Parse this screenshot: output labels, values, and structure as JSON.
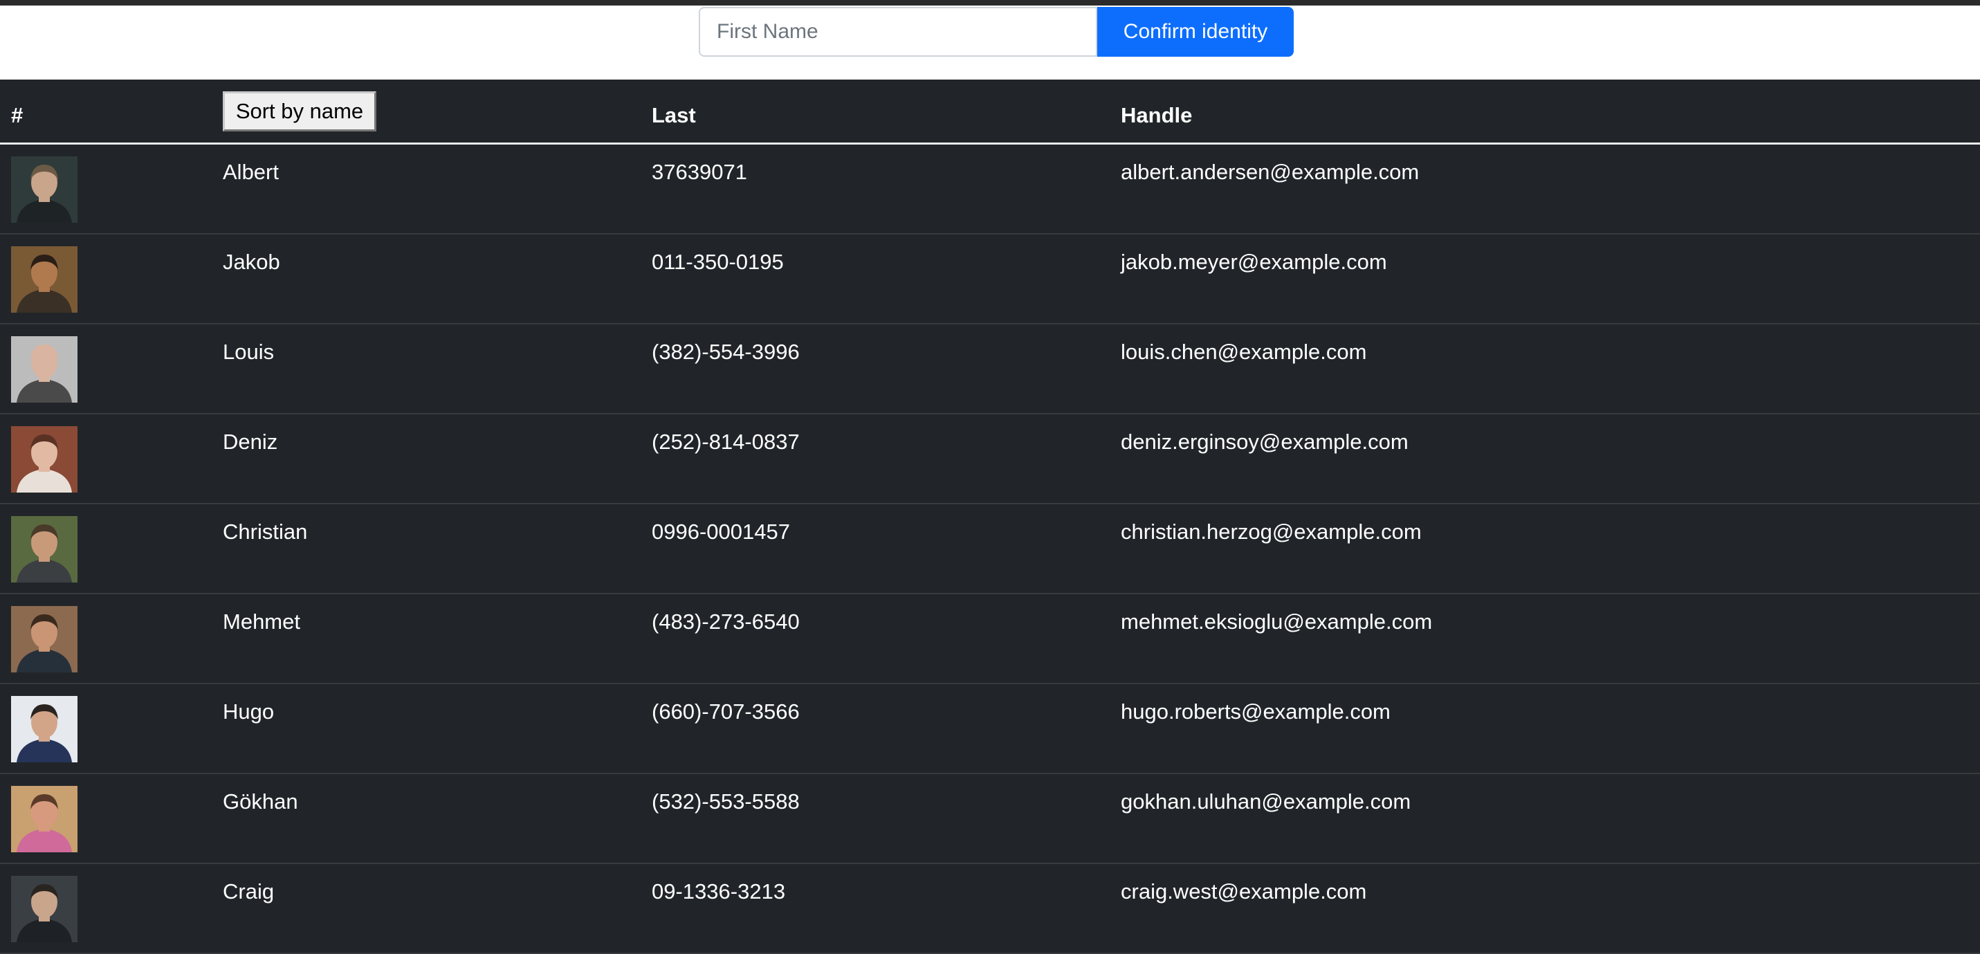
{
  "search": {
    "placeholder": "First Name",
    "value": "",
    "button_label": "Confirm identity"
  },
  "table": {
    "headers": {
      "index": "#",
      "sort_button": "Sort by name",
      "last": "Last",
      "handle": "Handle"
    },
    "rows": [
      {
        "first": "Albert",
        "last": "37639071",
        "handle": "albert.andersen@example.com",
        "bg": "#2f3b3a",
        "skin": "#c9a58c",
        "hair": "#6b5a45",
        "shirt": "#1e2426"
      },
      {
        "first": "Jakob",
        "last": "011-350-0195",
        "handle": "jakob.meyer@example.com",
        "bg": "#7a5a35",
        "skin": "#b07a4e",
        "hair": "#2a1e16",
        "shirt": "#3b3026"
      },
      {
        "first": "Louis",
        "last": "(382)-554-3996",
        "handle": "louis.chen@example.com",
        "bg": "#bcbcbc",
        "skin": "#d9b4a0",
        "hair": "#d9b4a0",
        "shirt": "#4a4a4a"
      },
      {
        "first": "Deniz",
        "last": "(252)-814-0837",
        "handle": "deniz.erginsoy@example.com",
        "bg": "#8a4a36",
        "skin": "#e2b9a2",
        "hair": "#5a3224",
        "shirt": "#e8e0d8"
      },
      {
        "first": "Christian",
        "last": "0996-0001457",
        "handle": "christian.herzog@example.com",
        "bg": "#5a6a40",
        "skin": "#c99a7a",
        "hair": "#4a3a2a",
        "shirt": "#3c3f42"
      },
      {
        "first": "Mehmet",
        "last": "(483)-273-6540",
        "handle": "mehmet.eksioglu@example.com",
        "bg": "#8c6a50",
        "skin": "#c99574",
        "hair": "#3a2a1e",
        "shirt": "#26303a"
      },
      {
        "first": "Hugo",
        "last": "(660)-707-3566",
        "handle": "hugo.roberts@example.com",
        "bg": "#e6e9ee",
        "skin": "#d2a488",
        "hair": "#2a2420",
        "shirt": "#26345a"
      },
      {
        "first": "Gökhan",
        "last": "(532)-553-5588",
        "handle": "gokhan.uluhan@example.com",
        "bg": "#c9a070",
        "skin": "#d89a7e",
        "hair": "#5a3a28",
        "shirt": "#d06a9a"
      },
      {
        "first": "Craig",
        "last": "09-1336-3213",
        "handle": "craig.west@example.com",
        "bg": "#3a3f44",
        "skin": "#c9a58c",
        "hair": "#2a2420",
        "shirt": "#1e2226"
      }
    ]
  }
}
